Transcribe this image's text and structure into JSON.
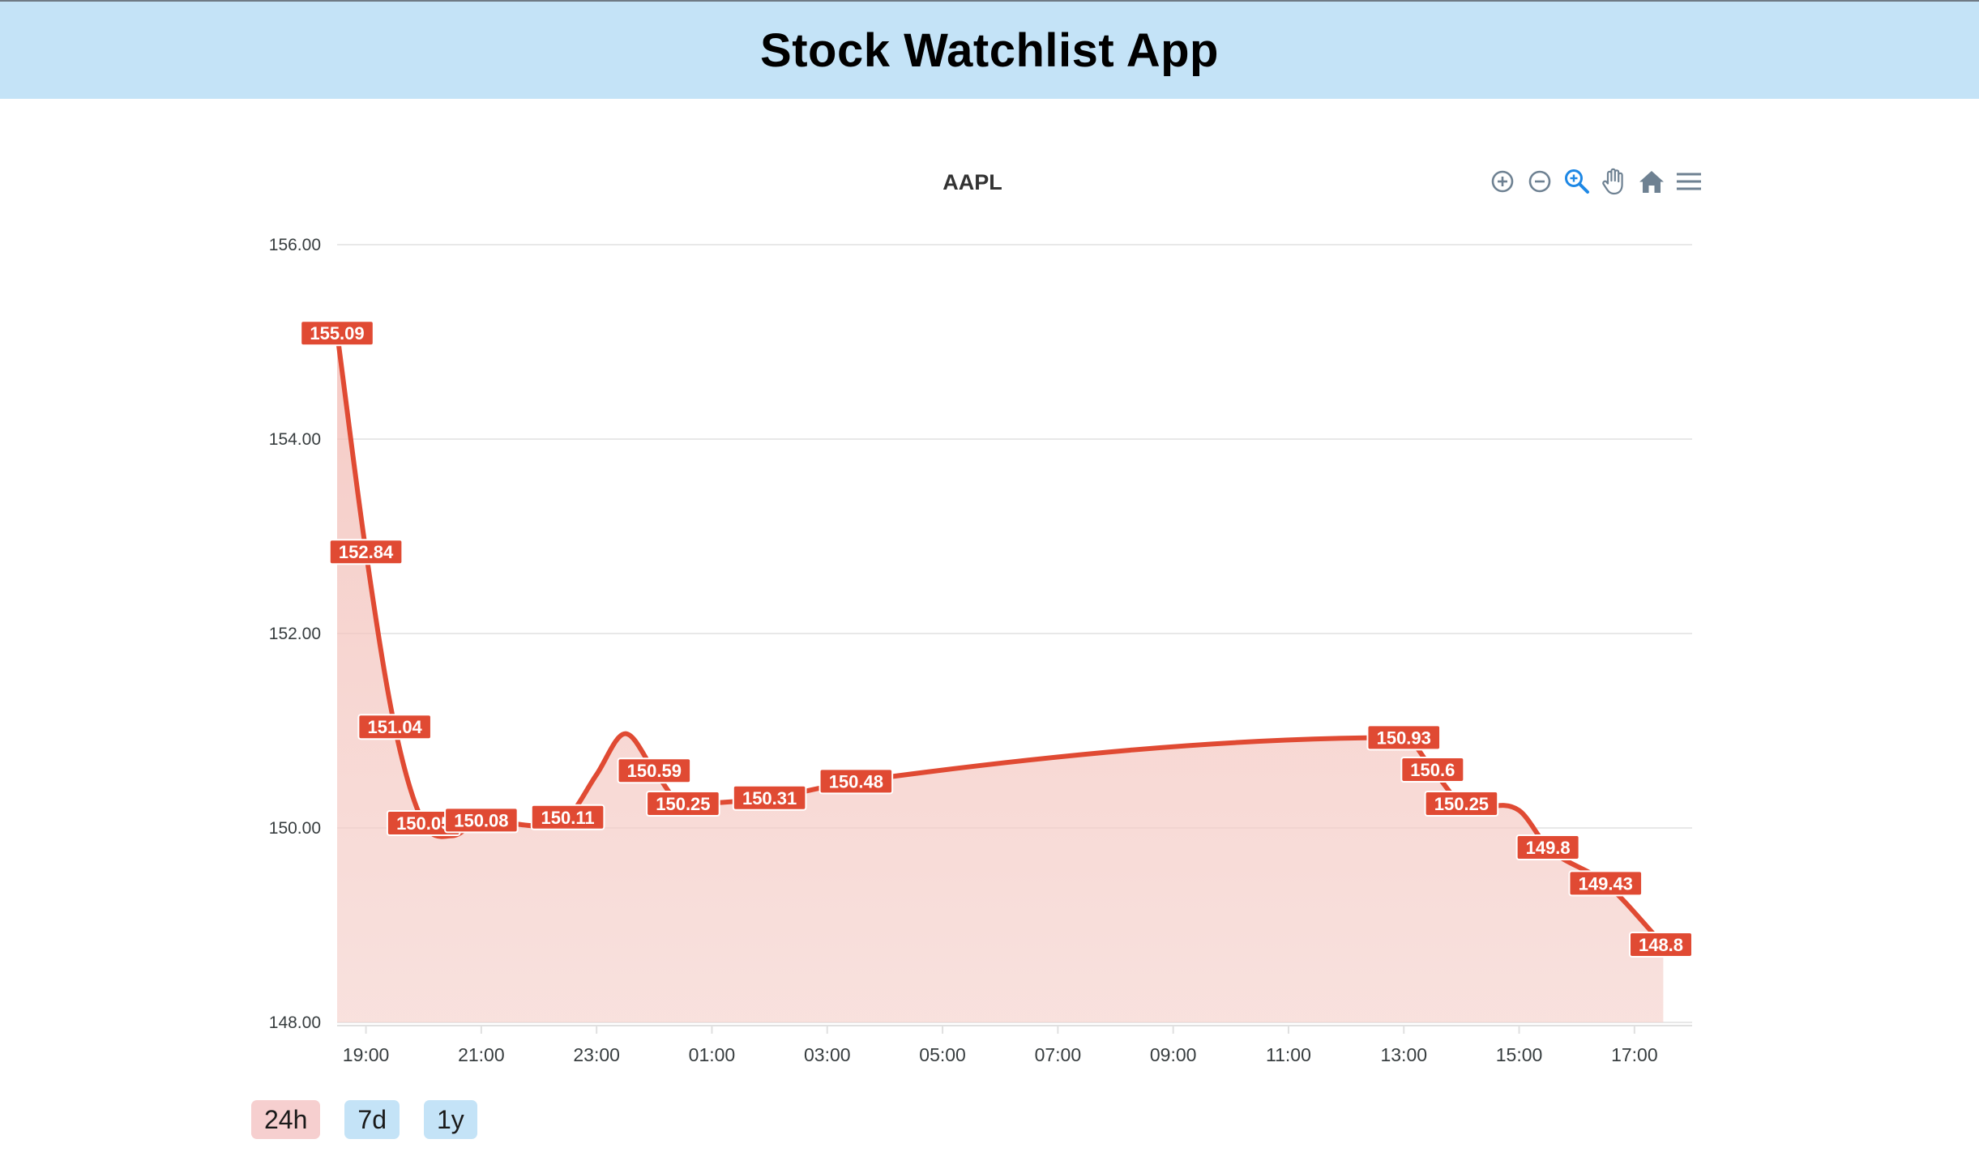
{
  "app": {
    "title": "Stock Watchlist App"
  },
  "toolbar": {
    "icons": [
      "zoom-in-icon",
      "zoom-out-icon",
      "selection-zoom-icon",
      "pan-hand-icon",
      "reset-home-icon",
      "menu-icon"
    ],
    "active_color": "#1e88e5",
    "icon_color": "#6e8192"
  },
  "range_buttons": [
    {
      "label": "24h",
      "active": true
    },
    {
      "label": "7d",
      "active": false
    },
    {
      "label": "1y",
      "active": false
    }
  ],
  "colors": {
    "header_bg": "#c4e3f7",
    "series_line": "#e04a33",
    "series_fill": "#f4c9c4",
    "label_bg": "#e04a33",
    "grid": "#e0e0e0"
  },
  "chart_data": {
    "type": "area",
    "title": "AAPL",
    "xlabel": "",
    "ylabel": "",
    "ylim": [
      148,
      156
    ],
    "yticks": [
      "148.00",
      "150.00",
      "152.00",
      "154.00",
      "156.00"
    ],
    "xticks": [
      "19:00",
      "21:00",
      "23:00",
      "01:00",
      "03:00",
      "05:00",
      "07:00",
      "09:00",
      "11:00",
      "13:00",
      "15:00",
      "17:00"
    ],
    "x_range_hours": [
      18.5,
      42.0
    ],
    "grid": true,
    "legend": "none",
    "points": [
      {
        "x": 18.5,
        "y": 155.09,
        "label": "155.09"
      },
      {
        "x": 19.0,
        "y": 152.84,
        "label": "152.84"
      },
      {
        "x": 19.5,
        "y": 151.04,
        "label": "151.04"
      },
      {
        "x": 20.0,
        "y": 150.05,
        "label": "150.05"
      },
      {
        "x": 20.5,
        "y": 149.92,
        "label": ""
      },
      {
        "x": 21.0,
        "y": 150.08,
        "label": "150.08"
      },
      {
        "x": 22.0,
        "y": 150.02,
        "label": ""
      },
      {
        "x": 22.5,
        "y": 150.11,
        "label": "150.11"
      },
      {
        "x": 23.0,
        "y": 150.55,
        "label": ""
      },
      {
        "x": 23.5,
        "y": 150.97,
        "label": ""
      },
      {
        "x": 24.0,
        "y": 150.59,
        "label": "150.59"
      },
      {
        "x": 24.5,
        "y": 150.25,
        "label": "150.25"
      },
      {
        "x": 26.0,
        "y": 150.31,
        "label": "150.31"
      },
      {
        "x": 27.5,
        "y": 150.48,
        "label": "150.48"
      },
      {
        "x": 37.0,
        "y": 150.93,
        "label": "150.93"
      },
      {
        "x": 37.5,
        "y": 150.6,
        "label": "150.6"
      },
      {
        "x": 38.0,
        "y": 150.25,
        "label": "150.25"
      },
      {
        "x": 39.0,
        "y": 150.18,
        "label": ""
      },
      {
        "x": 39.5,
        "y": 149.8,
        "label": "149.8"
      },
      {
        "x": 40.5,
        "y": 149.43,
        "label": "149.43"
      },
      {
        "x": 41.5,
        "y": 148.8,
        "label": "148.8"
      }
    ]
  }
}
